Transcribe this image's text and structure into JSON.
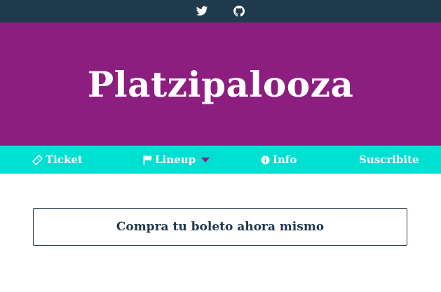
{
  "topbar": {
    "social": [
      {
        "icon": "twitter-icon"
      },
      {
        "icon": "github-icon"
      }
    ],
    "background": "#1f3a4d"
  },
  "hero": {
    "title": "Platzipalooza",
    "background": "#8c1e80"
  },
  "nav": {
    "background": "#00e0d2",
    "items": [
      {
        "label": "Ticket",
        "icon": "ticket-icon"
      },
      {
        "label": "Lineup",
        "icon": "flag-icon",
        "dropdown": true
      },
      {
        "label": "Info",
        "icon": "info-circle-icon"
      },
      {
        "label": "Suscribite"
      }
    ]
  },
  "cta": {
    "label": "Compra tu boleto ahora mismo"
  }
}
